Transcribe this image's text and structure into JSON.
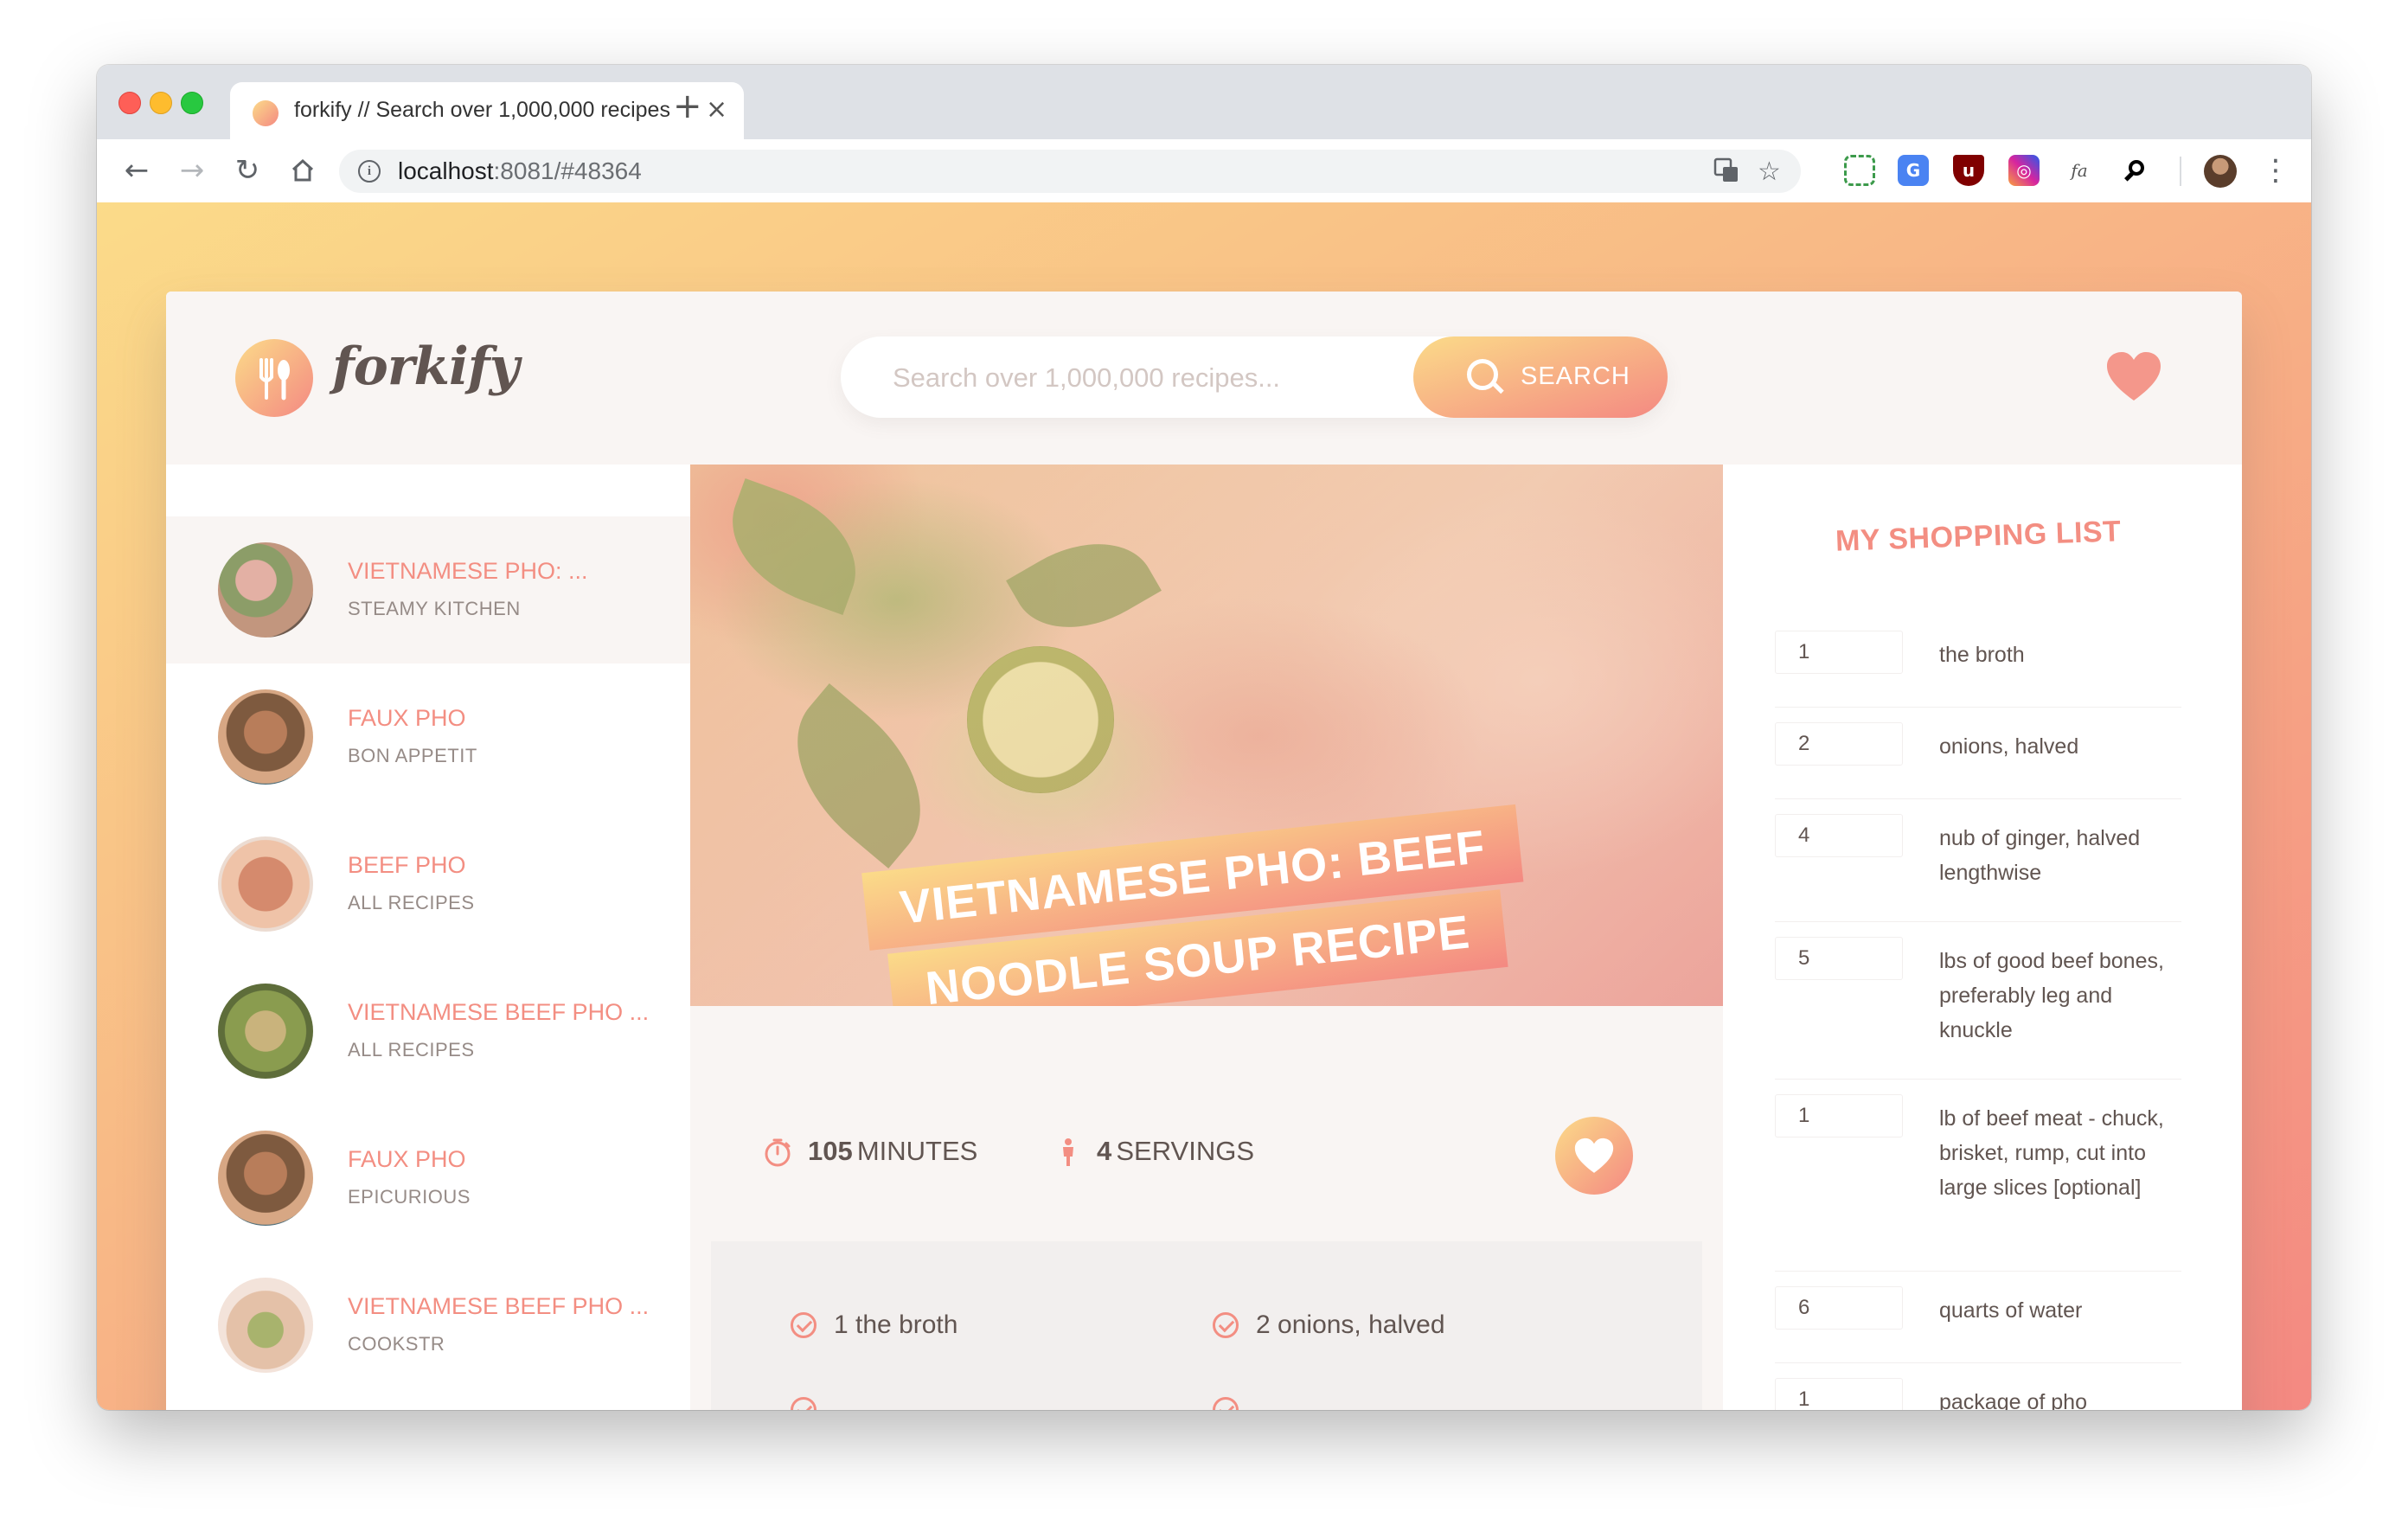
{
  "browser": {
    "tab_title": "forkify // Search over 1,000,000 recipes",
    "url_host": "localhost",
    "url_rest": ":8081/#48364",
    "new_tab": "+",
    "close": "×"
  },
  "header": {
    "logo_text": "forkify",
    "search_placeholder": "Search over 1,000,000 recipes...",
    "search_button": "SEARCH"
  },
  "results": [
    {
      "name": "Vietnamese Pho: ...",
      "author": "Steamy Kitchen"
    },
    {
      "name": "Faux Pho",
      "author": "Bon Appetit"
    },
    {
      "name": "Beef Pho",
      "author": "All Recipes"
    },
    {
      "name": "Vietnamese Beef Pho ...",
      "author": "All Recipes"
    },
    {
      "name": "Faux Pho",
      "author": "Epicurious"
    },
    {
      "name": "Vietnamese Beef Pho ...",
      "author": "Cookstr"
    }
  ],
  "recipe": {
    "title_line1": "Vietnamese Pho: Beef",
    "title_line2": "Noodle Soup Recipe",
    "minutes": "105",
    "minutes_label": "minutes",
    "servings": "4",
    "servings_label": "servings",
    "ingredients": [
      {
        "count": "1",
        "text": "the broth"
      },
      {
        "count": "2",
        "text": "onions, halved"
      }
    ]
  },
  "shopping": {
    "title": "My Shopping List",
    "items": [
      {
        "count": "1",
        "text": "the broth"
      },
      {
        "count": "2",
        "text": "onions, halved"
      },
      {
        "count": "4",
        "text": "nub of ginger, halved lengthwise"
      },
      {
        "count": "5",
        "text": "lbs of good beef bones, preferably leg and knuckle"
      },
      {
        "count": "1",
        "text": "lb of beef meat - chuck, brisket, rump, cut into large slices [optional]"
      },
      {
        "count": "6",
        "text": "quarts of water"
      },
      {
        "count": "1",
        "text": "package of pho"
      }
    ]
  },
  "colors": {
    "gradient_start": "#fbdb89",
    "gradient_end": "#f48982",
    "accent": "#f38e82",
    "text": "#615551"
  }
}
